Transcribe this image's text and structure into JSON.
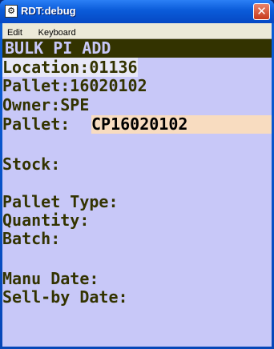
{
  "window": {
    "title": "RDT:debug",
    "close_glyph": "✕"
  },
  "menu": {
    "items": [
      "Edit",
      "Keyboard"
    ]
  },
  "screen": {
    "header": "BULK PI ADD",
    "location": "Location:01136",
    "pallet": "Pallet:16020102",
    "owner": "Owner:SPE",
    "pallet_input_label": "Pallet:",
    "pallet_input_value": "CP16020102",
    "stock": "Stock:",
    "pallet_type": "Pallet Type:",
    "quantity": "Quantity:",
    "batch": "Batch:",
    "manu_date": "Manu Date:",
    "sell_by_date": "Sell-by Date:"
  },
  "colors": {
    "screen_bg": "#c8c8f8",
    "text": "#333300",
    "header_bg": "#333300",
    "input_bg": "#f8dcc0"
  }
}
